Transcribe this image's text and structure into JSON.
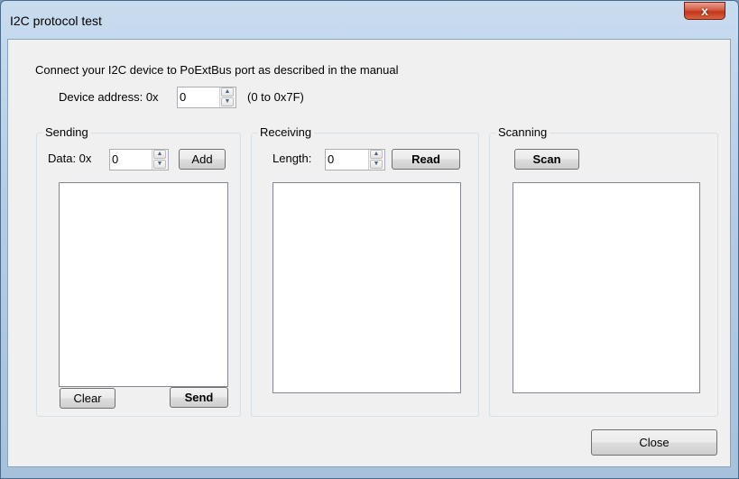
{
  "window": {
    "title": "I2C protocol test",
    "close_glyph": "x"
  },
  "instructions": "Connect your I2C device to PoExtBus port as described in the manual",
  "device_address": {
    "label": "Device address: 0x",
    "value": "0",
    "range_hint": "(0 to 0x7F)"
  },
  "sending": {
    "title": "Sending",
    "data_label": "Data: 0x",
    "data_value": "0",
    "add_label": "Add",
    "clear_label": "Clear",
    "send_label": "Send",
    "items": []
  },
  "receiving": {
    "title": "Receiving",
    "length_label": "Length:",
    "length_value": "0",
    "read_label": "Read",
    "items": []
  },
  "scanning": {
    "title": "Scanning",
    "scan_label": "Scan",
    "items": []
  },
  "footer": {
    "close_label": "Close"
  },
  "icons": {
    "spin_up": "up-arrow-icon",
    "spin_down": "down-arrow-icon"
  }
}
